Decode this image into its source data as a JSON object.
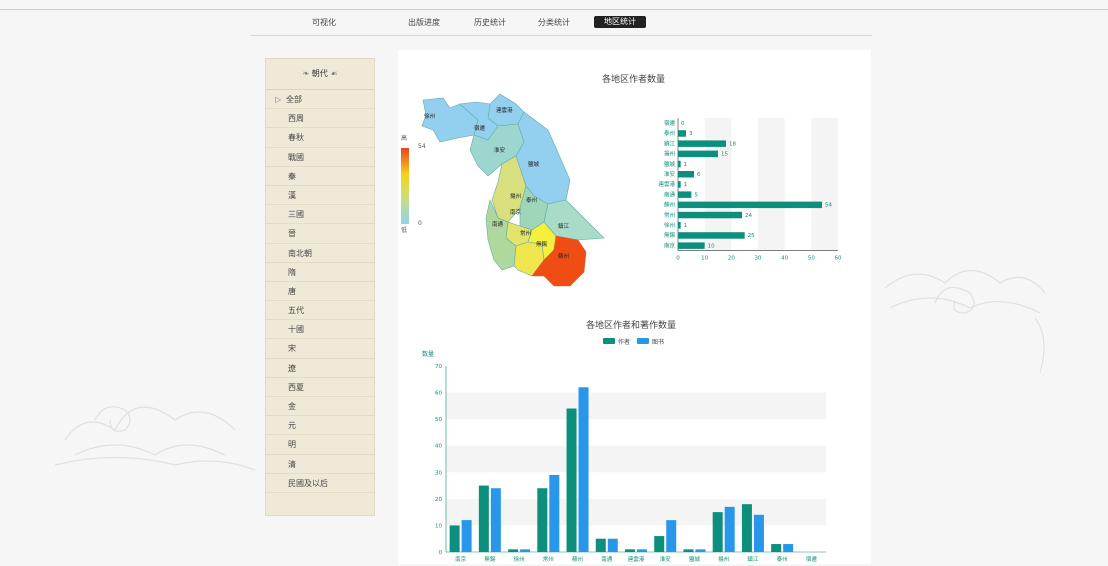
{
  "nav": {
    "items": [
      "可视化",
      "出版进度",
      "历史统计",
      "分类统计",
      "地区统计"
    ]
  },
  "sidebar": {
    "title": "朝代",
    "items": [
      "全部",
      "西周",
      "春秋",
      "戰國",
      "秦",
      "漢",
      "三國",
      "晉",
      "南北朝",
      "隋",
      "唐",
      "五代",
      "十國",
      "宋",
      "遼",
      "西夏",
      "金",
      "元",
      "明",
      "清",
      "民國及以后"
    ]
  },
  "map_chart": {
    "title": "各地区作者数量",
    "legend_high": "高",
    "legend_low": "低",
    "legend_max": "54",
    "legend_min": "0",
    "region_labels": [
      "徐州",
      "連雲港",
      "宿遷",
      "淮安",
      "鹽城",
      "揚州",
      "泰州",
      "鎮江",
      "南京",
      "南通",
      "常州",
      "無錫",
      "蘇州"
    ]
  },
  "chart_data": [
    {
      "type": "bar",
      "orientation": "horizontal",
      "categories": [
        "宿遷",
        "泰州",
        "鎮江",
        "揚州",
        "鹽城",
        "淮安",
        "連雲港",
        "南通",
        "蘇州",
        "常州",
        "徐州",
        "無錫",
        "南京"
      ],
      "values": [
        0,
        3,
        18,
        15,
        1,
        6,
        1,
        5,
        54,
        24,
        1,
        25,
        10
      ],
      "xlim": [
        0,
        60
      ],
      "xticks": [
        "0",
        "10",
        "20",
        "30",
        "40",
        "50",
        "60"
      ],
      "color": "#0c8f7c"
    },
    {
      "type": "bar",
      "title": "各地区作者和著作数量",
      "ylabel": "数量",
      "ylim": [
        0,
        70
      ],
      "yticks": [
        "0",
        "10",
        "20",
        "30",
        "40",
        "50",
        "60",
        "70"
      ],
      "categories": [
        "南京",
        "無錫",
        "徐州",
        "常州",
        "蘇州",
        "南通",
        "連雲港",
        "淮安",
        "鹽城",
        "揚州",
        "鎮江",
        "泰州",
        "宿遷"
      ],
      "series": [
        {
          "name": "作者",
          "color": "#0c8f7c",
          "values": [
            10,
            25,
            1,
            24,
            54,
            5,
            1,
            6,
            1,
            15,
            18,
            3,
            0
          ]
        },
        {
          "name": "图书",
          "color": "#2896e9",
          "values": [
            12,
            24,
            1,
            29,
            62,
            5,
            1,
            12,
            1,
            17,
            14,
            3,
            0
          ]
        }
      ]
    }
  ]
}
